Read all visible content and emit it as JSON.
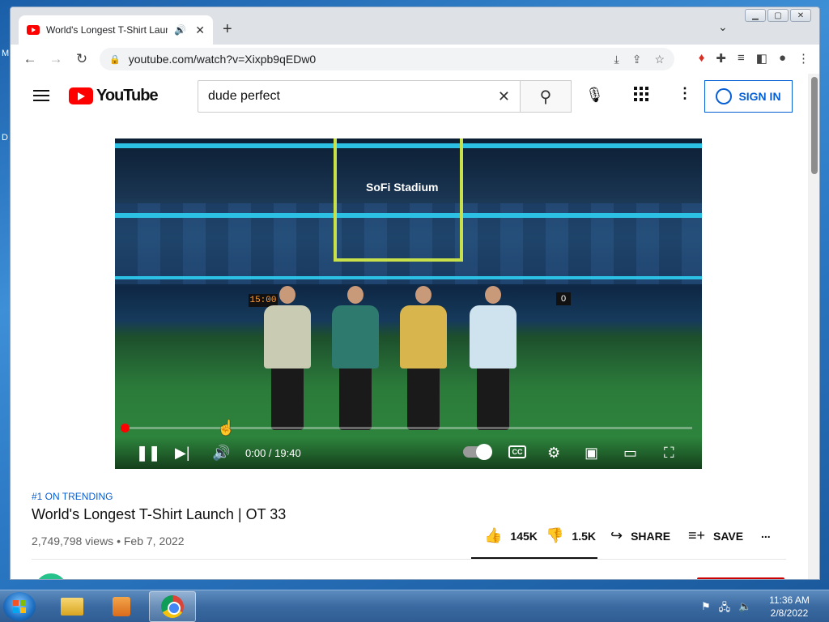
{
  "browser": {
    "tab_title": "World's Longest T-Shirt Laun",
    "tab_audio_icon": "speaker-icon",
    "tab_close": "✕",
    "new_tab": "+",
    "url": "youtube.com/watch?v=Xixpb9qEDw0"
  },
  "youtube": {
    "logo_text": "YouTube",
    "search_value": "dude perfect",
    "sign_in": "SIGN IN"
  },
  "video": {
    "stadium_label": "SoFi Stadium",
    "scoreboard_clock": "15:00",
    "scoreboard_score": "0",
    "time_current": "0:00",
    "time_total": "19:40",
    "time_display": "0:00 / 19:40",
    "progress_fraction": 0.0
  },
  "info": {
    "trending": "#1 ON TRENDING",
    "title": "World's Longest T-Shirt Launch | OT 33",
    "views_date": "2,749,798 views • Feb 7, 2022",
    "likes": "145K",
    "dislikes": "1.5K",
    "share": "SHARE",
    "save": "SAVE",
    "more": "..."
  },
  "taskbar": {
    "time": "11:36 AM",
    "date": "2/8/2022"
  },
  "colors": {
    "youtube_red": "#ff0000",
    "link_blue": "#065fd4"
  }
}
